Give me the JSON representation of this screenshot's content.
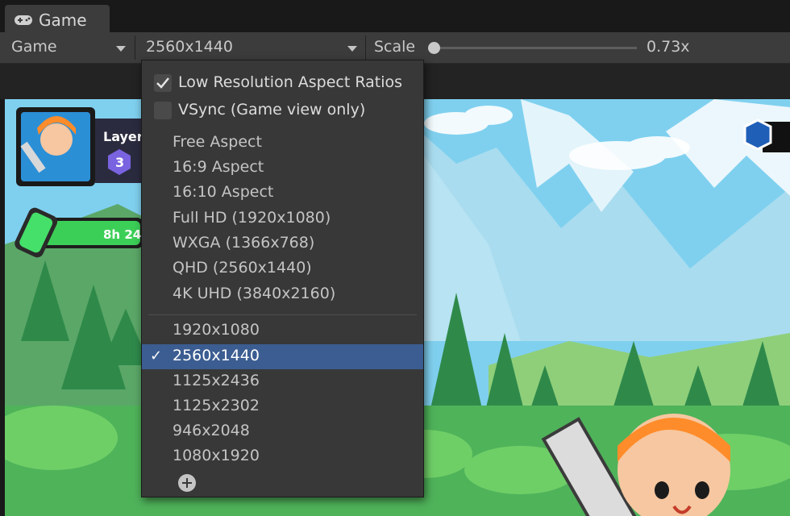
{
  "tab": {
    "title": "Game",
    "icon": "gamepad-icon"
  },
  "toolbar": {
    "display_label": "Game",
    "resolution_label": "2560x1440",
    "scale_label": "Scale",
    "scale_value": "0.73x",
    "scale_fraction": 0.0
  },
  "game": {
    "level_label": "Layer",
    "level_number": "3",
    "timer_text": "8h 24"
  },
  "menu": {
    "toggles": [
      {
        "label": "Low Resolution Aspect Ratios",
        "checked": true
      },
      {
        "label": "VSync (Game view only)",
        "checked": false
      }
    ],
    "builtin": [
      "Free Aspect",
      "16:9 Aspect",
      "16:10 Aspect",
      "Full HD (1920x1080)",
      "WXGA (1366x768)",
      "QHD (2560x1440)",
      "4K UHD (3840x2160)"
    ],
    "custom": [
      "1920x1080",
      "2560x1440",
      "1125x2436",
      "1125x2302",
      "946x2048",
      "1080x1920"
    ],
    "selected": "2560x1440",
    "selected_mark": "✓",
    "add_icon": "plus-circle-icon"
  },
  "colors": {
    "sky": "#7fd0ef",
    "selection": "#3b5d91",
    "panel": "#383838"
  }
}
